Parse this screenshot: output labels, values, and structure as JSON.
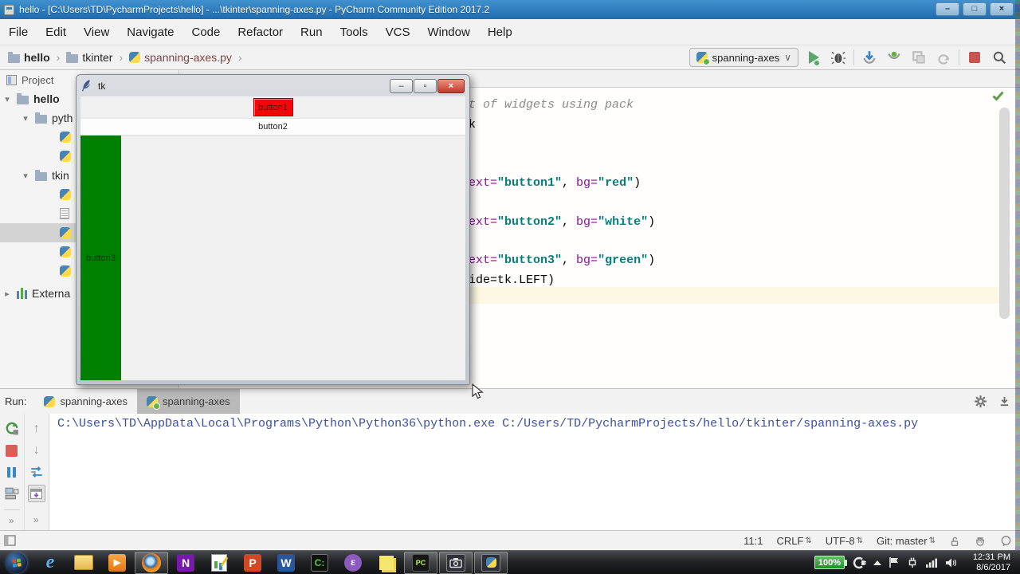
{
  "window": {
    "title": "hello - [C:\\Users\\TD\\PycharmProjects\\hello] - ...\\tkinter\\spanning-axes.py - PyCharm Community Edition 2017.2",
    "controls": {
      "minimize": "–",
      "maximize": "□",
      "close": "×"
    }
  },
  "menu": {
    "items": [
      "File",
      "Edit",
      "View",
      "Navigate",
      "Code",
      "Refactor",
      "Run",
      "Tools",
      "VCS",
      "Window",
      "Help"
    ]
  },
  "navbar": {
    "breadcrumbs": [
      "hello",
      "tkinter",
      "spanning-axes.py"
    ],
    "separator": "›",
    "run_config": "spanning-axes",
    "combo_chevron": "∨"
  },
  "project": {
    "header": "Project",
    "tree": {
      "root": "hello",
      "folder1": "pyth",
      "folder2": "tkin",
      "external": "Externa"
    },
    "expand_open": "▾",
    "expand_closed": "▸"
  },
  "editor": {
    "comment_frag": "t of widgets using pack",
    "import_frag": "k",
    "line_b1": {
      "p1": "ext=",
      "s1": "\"button1\"",
      "mid": ", ",
      "p2": "bg=",
      "s2": "\"red\"",
      "end": ")"
    },
    "line_b2": {
      "p1": "ext=",
      "s1": "\"button2\"",
      "mid": ", ",
      "p2": "bg=",
      "s2": "\"white\"",
      "end": ")"
    },
    "line_b3": {
      "p1": "ext=",
      "s1": "\"button3\"",
      "mid": ", ",
      "p2": "bg=",
      "s2": "\"green\"",
      "end": ")"
    },
    "line_pack": "ide=tk.LEFT)"
  },
  "tk_window": {
    "title": "tk",
    "button1": "button1",
    "button2": "button2",
    "button3": "button3",
    "button1_bg": "#f60606",
    "button2_bg": "#fdfdfd",
    "button3_bg": "#008000",
    "minimize": "–",
    "maximize": "▫",
    "close": "×"
  },
  "run_panel": {
    "label": "Run:",
    "tab1": "spanning-axes",
    "tab2": "spanning-axes",
    "console_line": "C:\\Users\\TD\\AppData\\Local\\Programs\\Python\\Python36\\python.exe C:/Users/TD/PycharmProjects/hello/tkinter/spanning-axes.py",
    "up_arrow": "↑",
    "down_arrow": "↓",
    "overflow": "»"
  },
  "status_bar": {
    "caret": "11:1",
    "line_sep": "CRLF",
    "encoding": "UTF-8",
    "vcs": "Git: master",
    "updown": "⇅"
  },
  "taskbar": {
    "battery": "100%",
    "time": "12:31 PM",
    "date": "8/6/2017",
    "glyphs": {
      "ie": "e",
      "onenote": "N",
      "powerpoint": "P",
      "word": "W",
      "pycharm": "PC",
      "emacs": "ε",
      "media_play": "▶",
      "console_prompt": "C:"
    }
  },
  "colors": {
    "titlebar_blue": "#2a7cbe",
    "run_green": "#59a869",
    "stop_red": "#c75450",
    "string_teal": "#077c7c",
    "param_purple": "#871094",
    "comment_gray": "#8a8a8a",
    "console_text": "#3b4fa0"
  }
}
